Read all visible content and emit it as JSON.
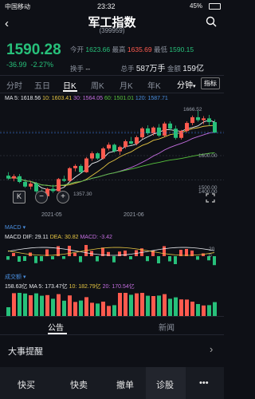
{
  "status": {
    "carrier": "中国移动",
    "time": "23:32",
    "battery": "45%"
  },
  "header": {
    "title": "军工指数",
    "code": "(399959)"
  },
  "price": {
    "current": "1590.28",
    "change": "-36.99",
    "change_pct": "-2.27%"
  },
  "quote": {
    "open_label": "今开",
    "open": "1623.66",
    "high_label": "最高",
    "high": "1635.69",
    "low_label": "最低",
    "low": "1590.15",
    "turnover_label": "换手",
    "turnover": "--",
    "volume_label": "总手",
    "volume": "587万手",
    "amount_label": "金额",
    "amount": "159亿"
  },
  "tabs": [
    "分时",
    "五日",
    "日K",
    "周K",
    "月K",
    "年K"
  ],
  "period_button": "分钟",
  "indicator_button": "指标",
  "ma": {
    "label": "MA 5: 1618.56",
    "ma10": "10: 1603.41",
    "ma30": "30: 1564.05",
    "ma60": "60: 1501.01",
    "ma120": "120: 1587.71"
  },
  "kchart": {
    "high_mark": "1666.52",
    "low_mark": "1357.30",
    "y_labels": [
      "1600.00",
      "1500.00",
      "1400.00"
    ],
    "dates": [
      "2021-05",
      "2021-06"
    ]
  },
  "macd": {
    "tag": "MACD",
    "label": "MACD",
    "dif": "DIF: 29.11",
    "dea": "DEA: 30.82",
    "macd": "MACD: -3.42",
    "y20": "20",
    "y0": "0"
  },
  "vol": {
    "tag": "成交额",
    "v1": "158.63亿",
    "ma5": "MA 5: 173.47亿",
    "ma10": "10: 182.79亿",
    "ma20": "20: 170.54亿"
  },
  "segments": [
    "公告",
    "新闻"
  ],
  "events_title": "大事提醒",
  "bottom": [
    "快买",
    "快卖",
    "撤单",
    "诊股",
    "•••"
  ],
  "colors": {
    "up": "#ff5a4e",
    "down": "#27c07a",
    "bg": "#0e1016"
  },
  "chart_data": {
    "type": "bar",
    "title": "军工指数 (399959) 日K",
    "candles": [
      {
        "o": 1440,
        "h": 1452,
        "l": 1425,
        "c": 1430
      },
      {
        "o": 1430,
        "h": 1445,
        "l": 1420,
        "c": 1438
      },
      {
        "o": 1438,
        "h": 1446,
        "l": 1414,
        "c": 1418
      },
      {
        "o": 1418,
        "h": 1428,
        "l": 1398,
        "c": 1402
      },
      {
        "o": 1402,
        "h": 1420,
        "l": 1392,
        "c": 1412
      },
      {
        "o": 1412,
        "h": 1418,
        "l": 1380,
        "c": 1385
      },
      {
        "o": 1385,
        "h": 1392,
        "l": 1357,
        "c": 1368
      },
      {
        "o": 1368,
        "h": 1398,
        "l": 1362,
        "c": 1394
      },
      {
        "o": 1394,
        "h": 1408,
        "l": 1380,
        "c": 1386
      },
      {
        "o": 1386,
        "h": 1432,
        "l": 1384,
        "c": 1428
      },
      {
        "o": 1428,
        "h": 1440,
        "l": 1418,
        "c": 1422
      },
      {
        "o": 1422,
        "h": 1470,
        "l": 1420,
        "c": 1466
      },
      {
        "o": 1466,
        "h": 1480,
        "l": 1455,
        "c": 1474
      },
      {
        "o": 1474,
        "h": 1480,
        "l": 1448,
        "c": 1452
      },
      {
        "o": 1452,
        "h": 1505,
        "l": 1450,
        "c": 1500
      },
      {
        "o": 1500,
        "h": 1525,
        "l": 1492,
        "c": 1518
      },
      {
        "o": 1518,
        "h": 1522,
        "l": 1495,
        "c": 1500
      },
      {
        "o": 1500,
        "h": 1540,
        "l": 1496,
        "c": 1535
      },
      {
        "o": 1535,
        "h": 1556,
        "l": 1528,
        "c": 1548
      },
      {
        "o": 1548,
        "h": 1552,
        "l": 1520,
        "c": 1525
      },
      {
        "o": 1525,
        "h": 1545,
        "l": 1512,
        "c": 1540
      },
      {
        "o": 1540,
        "h": 1566,
        "l": 1534,
        "c": 1560
      },
      {
        "o": 1560,
        "h": 1575,
        "l": 1548,
        "c": 1552
      },
      {
        "o": 1552,
        "h": 1580,
        "l": 1546,
        "c": 1574
      },
      {
        "o": 1574,
        "h": 1610,
        "l": 1568,
        "c": 1605
      },
      {
        "o": 1605,
        "h": 1616,
        "l": 1582,
        "c": 1588
      },
      {
        "o": 1588,
        "h": 1612,
        "l": 1580,
        "c": 1608
      },
      {
        "o": 1608,
        "h": 1620,
        "l": 1575,
        "c": 1580
      },
      {
        "o": 1580,
        "h": 1628,
        "l": 1576,
        "c": 1622
      },
      {
        "o": 1622,
        "h": 1630,
        "l": 1598,
        "c": 1604
      },
      {
        "o": 1604,
        "h": 1615,
        "l": 1566,
        "c": 1572
      },
      {
        "o": 1572,
        "h": 1600,
        "l": 1566,
        "c": 1596
      },
      {
        "o": 1596,
        "h": 1630,
        "l": 1590,
        "c": 1624
      },
      {
        "o": 1624,
        "h": 1650,
        "l": 1616,
        "c": 1644
      },
      {
        "o": 1644,
        "h": 1666,
        "l": 1628,
        "c": 1634
      },
      {
        "o": 1634,
        "h": 1648,
        "l": 1620,
        "c": 1640
      },
      {
        "o": 1640,
        "h": 1652,
        "l": 1614,
        "c": 1627
      },
      {
        "o": 1627,
        "h": 1636,
        "l": 1590,
        "c": 1590
      }
    ],
    "ylim": [
      1340,
      1680
    ]
  }
}
